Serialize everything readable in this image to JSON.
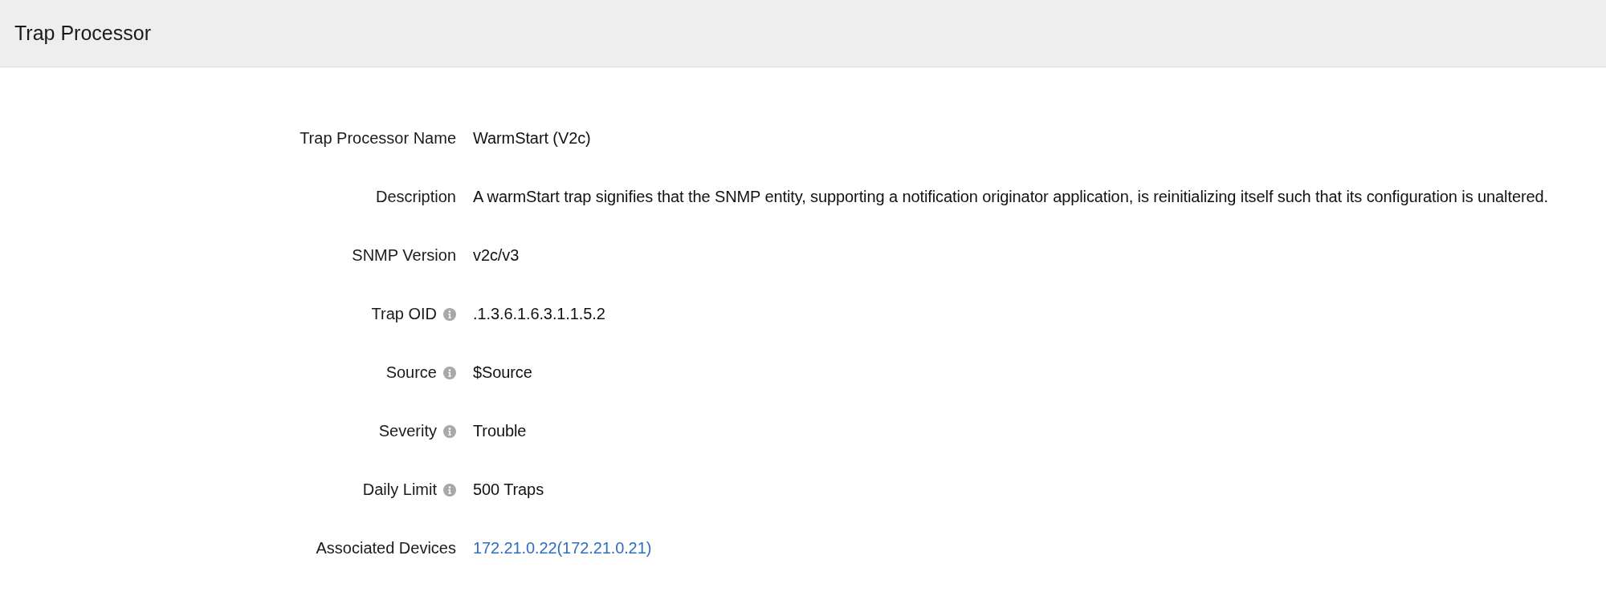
{
  "header": {
    "title": "Trap Processor"
  },
  "fields": [
    {
      "label": "Trap Processor Name",
      "info": false,
      "kind": "text",
      "value": "WarmStart (V2c)"
    },
    {
      "label": "Description",
      "info": false,
      "kind": "text",
      "value": "A warmStart trap signifies that the SNMP entity, supporting a notification originator application, is reinitializing itself such that its configuration is unaltered."
    },
    {
      "label": "SNMP Version",
      "info": false,
      "kind": "text",
      "value": "v2c/v3"
    },
    {
      "label": "Trap OID",
      "info": true,
      "kind": "text",
      "value": ".1.3.6.1.6.3.1.1.5.2"
    },
    {
      "label": "Source",
      "info": true,
      "kind": "text",
      "value": "$Source"
    },
    {
      "label": "Severity",
      "info": true,
      "kind": "text",
      "value": "Trouble"
    },
    {
      "label": "Daily Limit",
      "info": true,
      "kind": "text",
      "value": "500 Traps"
    },
    {
      "label": "Associated Devices",
      "info": false,
      "kind": "link",
      "value": "172.21.0.22(172.21.0.21)"
    }
  ]
}
